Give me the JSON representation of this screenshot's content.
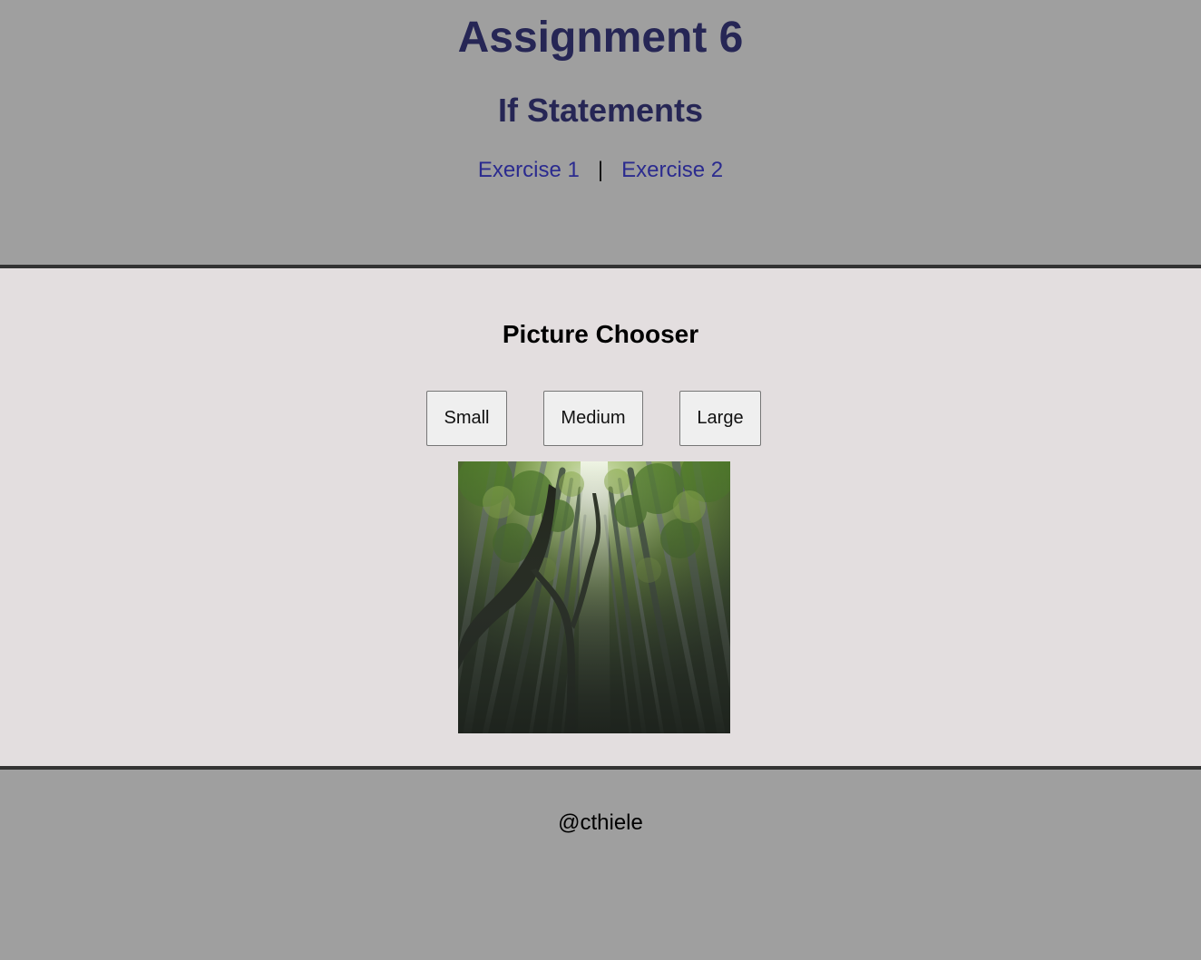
{
  "header": {
    "title": "Assignment 6",
    "subtitle": "If Statements",
    "nav": {
      "links": [
        {
          "label": "Exercise 1"
        },
        {
          "label": "Exercise 2"
        }
      ],
      "separator": "|"
    }
  },
  "main": {
    "heading": "Picture Chooser",
    "buttons": {
      "small": "Small",
      "medium": "Medium",
      "large": "Large"
    }
  },
  "footer": {
    "credit": "@cthiele"
  }
}
